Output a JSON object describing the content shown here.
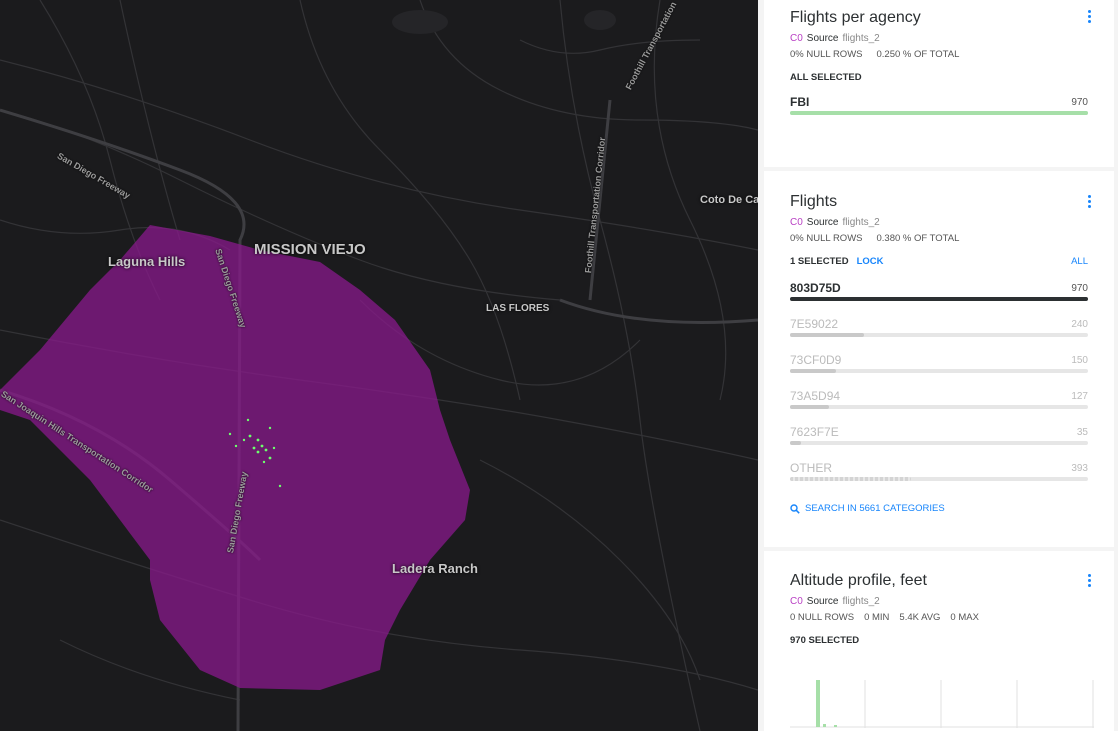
{
  "map": {
    "labels": {
      "mission_viejo": "MISSION VIEJO",
      "laguna_hills": "Laguna Hills",
      "las_flores": "LAS FLORES",
      "ladera_ranch": "Ladera Ranch",
      "coto_de_caza": "Coto De Ca"
    },
    "roads": {
      "sd_freeway_1": "San Diego Freeway",
      "sd_freeway_2": "San Diego Freeway",
      "sd_freeway_3": "San Diego Freeway",
      "sj_hills": "San Joaquin Hills Transportation Corridor",
      "foothill_1": "Foothill Transportation",
      "foothill_2": "Foothill Transportation Corridor"
    }
  },
  "widgets": {
    "agency": {
      "title": "Flights per agency",
      "source_tag": "C0",
      "source_label": "Source",
      "dataset": "flights_2",
      "null_rows": "0% NULL ROWS",
      "pct_total": "0.250 % OF TOTAL",
      "selection": "ALL SELECTED",
      "rows": [
        {
          "label": "FBI",
          "value": "970",
          "fraction": 1.0
        }
      ]
    },
    "flights": {
      "title": "Flights",
      "source_tag": "C0",
      "source_label": "Source",
      "dataset": "flights_2",
      "null_rows": "0% NULL ROWS",
      "pct_total": "0.380 % OF TOTAL",
      "selection": "1 SELECTED",
      "lock": "LOCK",
      "all": "ALL",
      "rows": [
        {
          "label": "803D75D",
          "value": "970",
          "fraction": 1.0
        },
        {
          "label": "7E59022",
          "value": "240",
          "fraction": 0.247
        },
        {
          "label": "73CF0D9",
          "value": "150",
          "fraction": 0.155
        },
        {
          "label": "73A5D94",
          "value": "127",
          "fraction": 0.131
        },
        {
          "label": "7623F7E",
          "value": "35",
          "fraction": 0.036
        },
        {
          "label": "OTHER",
          "value": "393",
          "fraction": 0.405
        }
      ],
      "search": "SEARCH IN 5661 CATEGORIES"
    },
    "altitude": {
      "title": "Altitude profile, feet",
      "source_tag": "C0",
      "source_label": "Source",
      "dataset": "flights_2",
      "null_rows": "0 NULL ROWS",
      "min": "0 MIN",
      "avg": "5.4K AVG",
      "max": "0 MAX",
      "selection": "970 SELECTED"
    }
  },
  "colors": {
    "accent": "#1785fb",
    "bar_green": "#a6dfa8",
    "bar_dark": "#2c3032",
    "polygon": "#8a1a8c",
    "points": "#6dff6d"
  }
}
